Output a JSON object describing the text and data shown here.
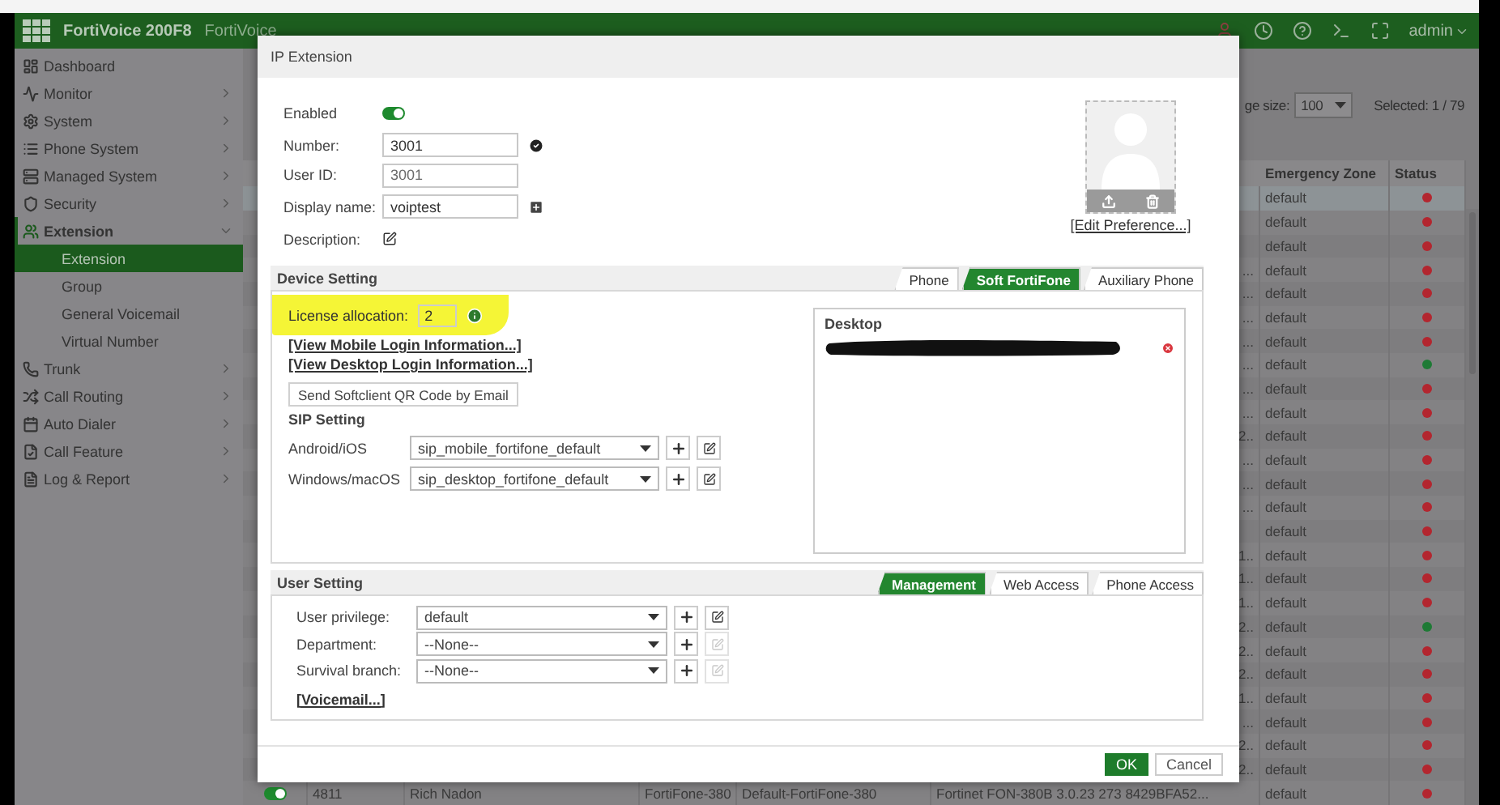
{
  "header": {
    "product": "FortiVoice 200F8",
    "subtitle": "FortiVoice",
    "user": "admin"
  },
  "sidebar": {
    "items": [
      {
        "label": "Dashboard",
        "kind": "page"
      },
      {
        "label": "Monitor",
        "kind": "menu",
        "expanded": false
      },
      {
        "label": "System",
        "kind": "menu",
        "expanded": false
      },
      {
        "label": "Phone System",
        "kind": "menu",
        "expanded": false
      },
      {
        "label": "Managed System",
        "kind": "menu",
        "expanded": false
      },
      {
        "label": "Security",
        "kind": "menu",
        "expanded": false
      },
      {
        "label": "Extension",
        "kind": "menu",
        "expanded": true,
        "children": [
          {
            "label": "Extension",
            "selected": true
          },
          {
            "label": "Group",
            "selected": false
          },
          {
            "label": "General Voicemail",
            "selected": false
          },
          {
            "label": "Virtual Number",
            "selected": false
          }
        ]
      },
      {
        "label": "Trunk",
        "kind": "menu",
        "expanded": false
      },
      {
        "label": "Call Routing",
        "kind": "menu",
        "expanded": false
      },
      {
        "label": "Auto Dialer",
        "kind": "menu",
        "expanded": false
      },
      {
        "label": "Call Feature",
        "kind": "menu",
        "expanded": false
      },
      {
        "label": "Log & Report",
        "kind": "menu",
        "expanded": false
      }
    ]
  },
  "toolbar": {
    "page_size_label": "ge size:",
    "page_size": "100",
    "selected_count": "Selected: 1 / 79"
  },
  "table": {
    "columns": [
      {
        "label": "Emergency Zone"
      },
      {
        "label": "Status"
      }
    ],
    "rows": [
      {
        "kind": "partial",
        "column_6": "",
        "zone": "default",
        "color": "#b3262f",
        "selected": true
      },
      {
        "kind": "partial",
        "column_6": "",
        "zone": "default",
        "color": "#b3262f",
        "selected": false
      },
      {
        "kind": "partial",
        "column_6": "",
        "zone": "default",
        "color": "#b3262f",
        "selected": false
      },
      {
        "kind": "partial",
        "column_6": "...",
        "zone": "default",
        "color": "#b3262f",
        "selected": false
      },
      {
        "kind": "partial",
        "column_6": "...",
        "zone": "default",
        "color": "#b3262f",
        "selected": false
      },
      {
        "kind": "partial",
        "column_6": "...",
        "zone": "default",
        "color": "#b3262f",
        "selected": false
      },
      {
        "kind": "partial",
        "column_6": "...",
        "zone": "default",
        "color": "#b3262f",
        "selected": false
      },
      {
        "kind": "partial",
        "column_6": "...",
        "zone": "default",
        "color": "#1e7a35",
        "selected": false
      },
      {
        "kind": "partial",
        "column_6": "...",
        "zone": "default",
        "color": "#b3262f",
        "selected": false
      },
      {
        "kind": "partial",
        "column_6": "...",
        "zone": "default",
        "color": "#b3262f",
        "selected": false
      },
      {
        "kind": "partial",
        "column_6": "2..",
        "zone": "default",
        "color": "#b3262f",
        "selected": false
      },
      {
        "kind": "partial",
        "column_6": "...",
        "zone": "default",
        "color": "#b3262f",
        "selected": false
      },
      {
        "kind": "partial",
        "column_6": "...",
        "zone": "default",
        "color": "#b3262f",
        "selected": false
      },
      {
        "kind": "partial",
        "column_6": "...",
        "zone": "default",
        "color": "#b3262f",
        "selected": false
      },
      {
        "kind": "partial",
        "column_6": "",
        "zone": "default",
        "color": "#b3262f",
        "selected": false
      },
      {
        "kind": "partial",
        "column_6": "1..",
        "zone": "default",
        "color": "#b3262f",
        "selected": false
      },
      {
        "kind": "partial",
        "column_6": "1..",
        "zone": "default",
        "color": "#b3262f",
        "selected": false
      },
      {
        "kind": "partial",
        "column_6": "1..",
        "zone": "default",
        "color": "#b3262f",
        "selected": false
      },
      {
        "kind": "partial",
        "column_6": "2..",
        "zone": "default",
        "color": "#1e7a35",
        "selected": false
      },
      {
        "kind": "partial",
        "column_6": "2..",
        "zone": "default",
        "color": "#b3262f",
        "selected": false
      },
      {
        "kind": "partial",
        "column_6": "2..",
        "zone": "default",
        "color": "#b3262f",
        "selected": false
      },
      {
        "kind": "partial",
        "column_6": "1..",
        "zone": "default",
        "color": "#b3262f",
        "selected": false
      },
      {
        "kind": "partial",
        "column_6": "...",
        "zone": "default",
        "color": "#b3262f",
        "selected": false
      },
      {
        "kind": "partial",
        "column_6": "2..",
        "zone": "default",
        "color": "#b3262f",
        "selected": false
      },
      {
        "kind": "partial",
        "column_6": "2..",
        "zone": "default",
        "color": "#b3262f",
        "selected": false
      },
      {
        "kind": "full",
        "enabled": true,
        "number": "4811",
        "name": "Rich Nadon",
        "model": "FortiFone-380",
        "profile": "Default-FortiFone-380",
        "column_6": "Fortinet FON-380B 3.0.23 273 8429BFA52...",
        "zone": "default",
        "color": "#b3262f",
        "selected": false
      }
    ]
  },
  "modal": {
    "title": "IP Extension",
    "enabled": {
      "label": "Enabled",
      "on": true
    },
    "fields": [
      {
        "kind": "number",
        "label": "Number:",
        "value": "3001"
      },
      {
        "kind": "readonly",
        "label": "User ID:",
        "value": "3001"
      },
      {
        "kind": "name",
        "label": "Display name:",
        "value": "voiptest"
      },
      {
        "kind": "description",
        "label": "Description:"
      }
    ],
    "avatar_link": "[Edit Preference...]",
    "device_setting": {
      "title": "Device Setting",
      "tabs": [
        {
          "label": "Phone",
          "selected": false
        },
        {
          "label": "Soft FortiFone",
          "selected": true
        },
        {
          "label": "Auxiliary Phone",
          "selected": false
        }
      ],
      "license": {
        "label": "License allocation:",
        "value": "2",
        "highlighted": true
      },
      "links": [
        "[View Mobile Login Information...]",
        "[View Desktop Login Information...]"
      ],
      "qr_button": "Send Softclient QR Code by Email",
      "sip_title": "SIP Setting",
      "sip_rows": [
        {
          "label": "Android/iOS",
          "value": "sip_mobile_fortifone_default",
          "edit_disabled": false
        },
        {
          "label": "Windows/macOS",
          "value": "sip_desktop_fortifone_default",
          "edit_disabled": false
        }
      ],
      "desktop_title": "Desktop"
    },
    "user_setting": {
      "title": "User Setting",
      "tabs": [
        {
          "label": "Management",
          "selected": true
        },
        {
          "label": "Web Access",
          "selected": false
        },
        {
          "label": "Phone Access",
          "selected": false
        }
      ],
      "rows": [
        {
          "label": "User privilege:",
          "value": "default",
          "edit_disabled": false
        },
        {
          "label": "Department:",
          "value": "--None--",
          "edit_disabled": true
        },
        {
          "label": "Survival branch:",
          "value": "--None--",
          "edit_disabled": true
        }
      ],
      "link": "[Voicemail...]"
    },
    "buttons": [
      {
        "label": "OK",
        "kind": "primary"
      },
      {
        "label": "Cancel",
        "kind": "secondary"
      }
    ]
  }
}
